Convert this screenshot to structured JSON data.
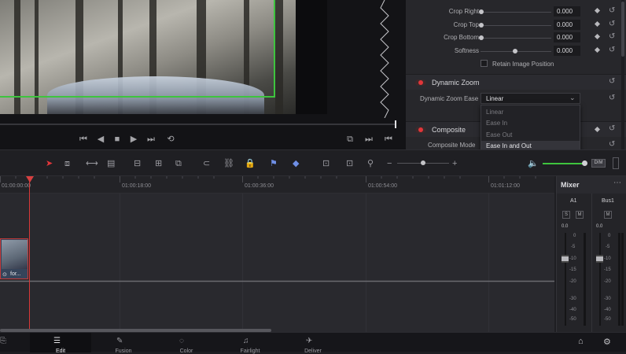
{
  "inspector": {
    "rows": [
      {
        "label": "Crop Right",
        "value": "0.000"
      },
      {
        "label": "Crop Top",
        "value": "0.000"
      },
      {
        "label": "Crop Bottom",
        "value": "0.000"
      },
      {
        "label": "Softness",
        "value": "0.000"
      }
    ],
    "retain_label": "Retain Image Position",
    "dynamic_zoom": {
      "title": "Dynamic Zoom",
      "ease_label": "Dynamic Zoom Ease",
      "ease_value": "Linear"
    },
    "composite": {
      "title": "Composite",
      "mode_label": "Composite Mode"
    }
  },
  "dropdown": {
    "options": [
      "Linear",
      "Ease In",
      "Ease Out",
      "Ease In and Out"
    ],
    "highlighted": "Ease In and Out"
  },
  "toolbar": {
    "dim_label": "DIM"
  },
  "ruler": {
    "timecodes": [
      "01:00:00:00",
      "01:00:18:00",
      "01:00:36:00",
      "01:00:54:00",
      "01:01:12:00"
    ]
  },
  "clip": {
    "label": "for..."
  },
  "mixer": {
    "title": "Mixer",
    "channels": [
      {
        "name": "A1",
        "solo": "S",
        "mute": "M",
        "level": "0.0"
      },
      {
        "name": "Bus1",
        "mute": "M",
        "level": "0.0"
      }
    ],
    "scale": [
      "0",
      "-5",
      "-10",
      "-15",
      "-20",
      "-30",
      "-40",
      "-50"
    ]
  },
  "pages": [
    {
      "label": "Edit",
      "icon": "edit-icon"
    },
    {
      "label": "Fusion",
      "icon": "fusion-icon"
    },
    {
      "label": "Color",
      "icon": "color-icon"
    },
    {
      "label": "Fairlight",
      "icon": "fairlight-icon"
    },
    {
      "label": "Deliver",
      "icon": "deliver-icon"
    }
  ],
  "colors": {
    "accent_red": "#e2363a",
    "zoom_box": "#3ec43e",
    "playhead": "#d83838"
  }
}
